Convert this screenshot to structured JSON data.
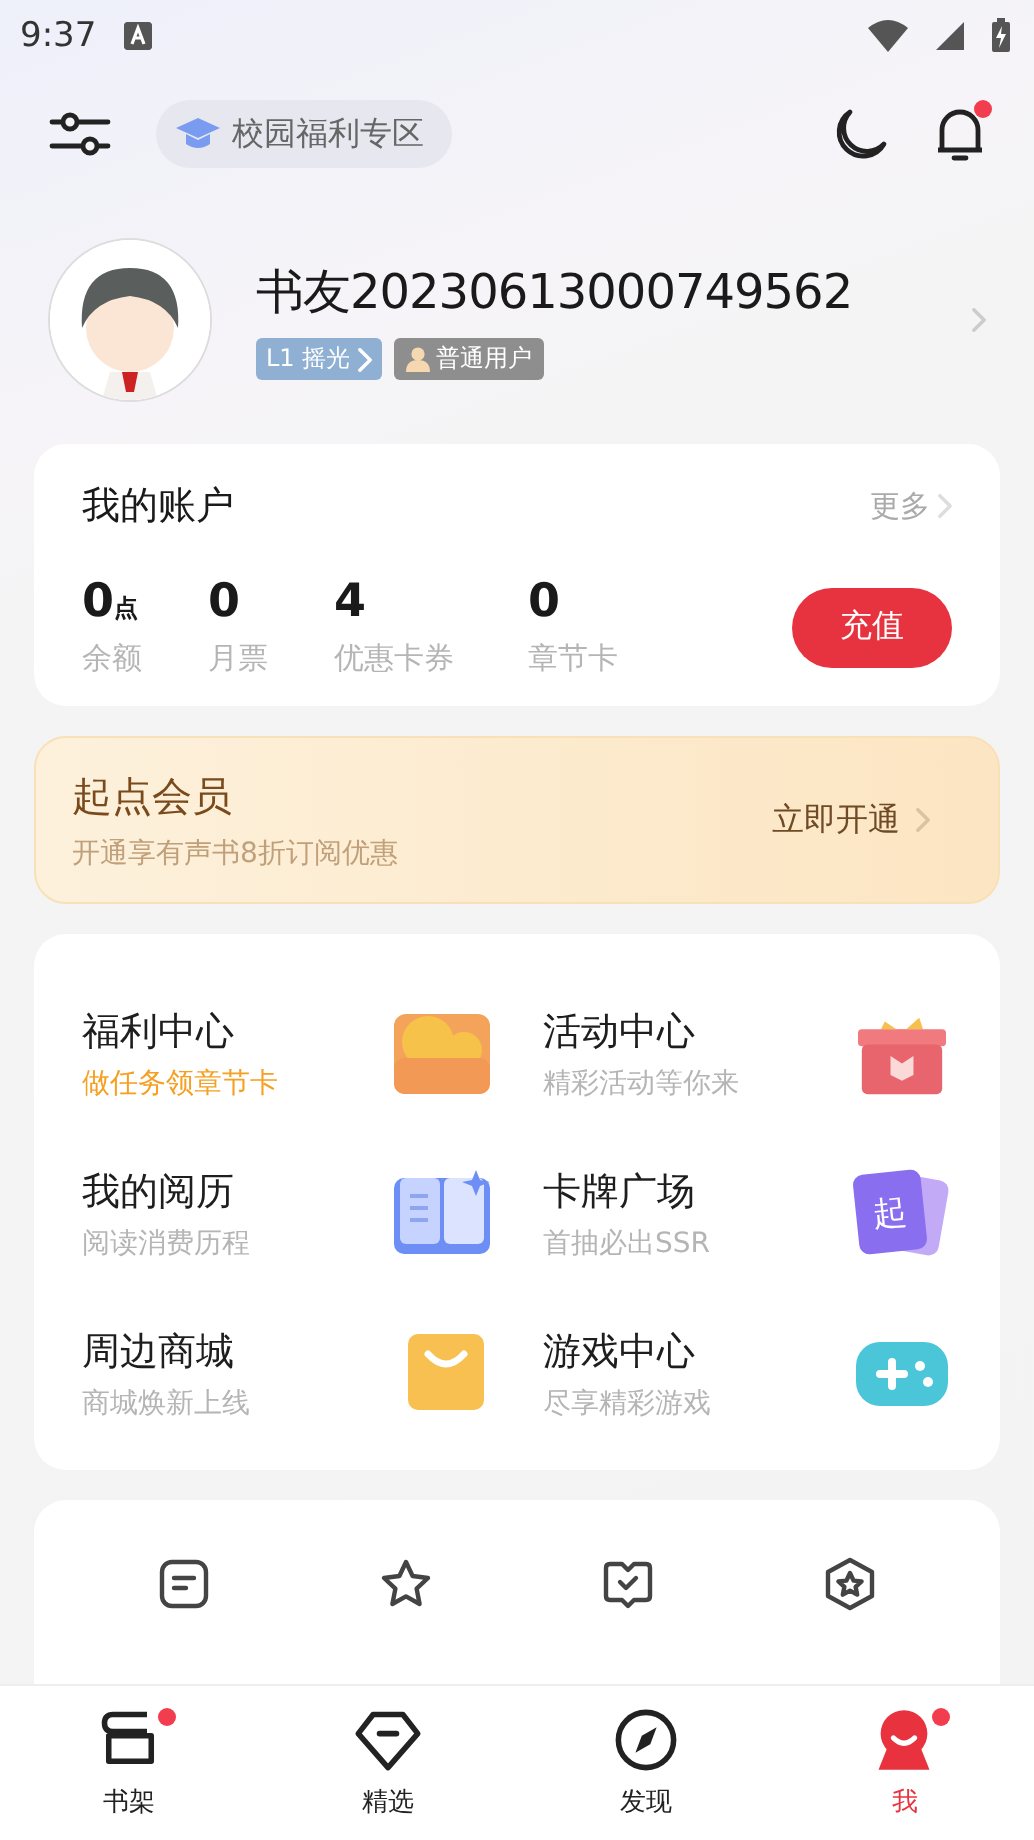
{
  "status_bar": {
    "time": "9:37"
  },
  "top_bar": {
    "campus_button": "校园福利专区",
    "notification_badge": true
  },
  "profile": {
    "name": "书友20230613000749562",
    "level": "L1 摇光",
    "role": "普通用户"
  },
  "account": {
    "title": "我的账户",
    "more": "更多",
    "stats": [
      {
        "value": "0",
        "unit": "点",
        "label": "余额"
      },
      {
        "value": "0",
        "label": "月票"
      },
      {
        "value": "4",
        "label": "优惠卡券"
      },
      {
        "value": "0",
        "label": "章节卡"
      }
    ],
    "recharge": "充值"
  },
  "membership": {
    "title": "起点会员",
    "subtitle": "开通享有声书8折订阅优惠",
    "action": "立即开通"
  },
  "features": [
    {
      "title": "福利中心",
      "subtitle": "做任务领章节卡",
      "highlight": true,
      "kind": "coins"
    },
    {
      "title": "活动中心",
      "subtitle": "精彩活动等你来",
      "highlight": false,
      "kind": "gift"
    },
    {
      "title": "我的阅历",
      "subtitle": "阅读消费历程",
      "highlight": false,
      "kind": "book"
    },
    {
      "title": "卡牌广场",
      "subtitle": "首抽必出SSR",
      "highlight": false,
      "kind": "cards",
      "icon_text": "起"
    },
    {
      "title": "周边商城",
      "subtitle": "商城焕新上线",
      "highlight": false,
      "kind": "bag"
    },
    {
      "title": "游戏中心",
      "subtitle": "尽享精彩游戏",
      "highlight": false,
      "kind": "gamepad"
    }
  ],
  "shortcuts": [
    {
      "kind": "note"
    },
    {
      "kind": "star"
    },
    {
      "kind": "chat"
    },
    {
      "kind": "badge"
    }
  ],
  "nav": [
    {
      "label": "书架",
      "kind": "shelf",
      "selected": false,
      "badge": true
    },
    {
      "label": "精选",
      "kind": "diamond",
      "selected": false,
      "badge": false
    },
    {
      "label": "发现",
      "kind": "compass",
      "selected": false,
      "badge": false
    },
    {
      "label": "我",
      "kind": "me",
      "selected": true,
      "badge": true
    }
  ]
}
